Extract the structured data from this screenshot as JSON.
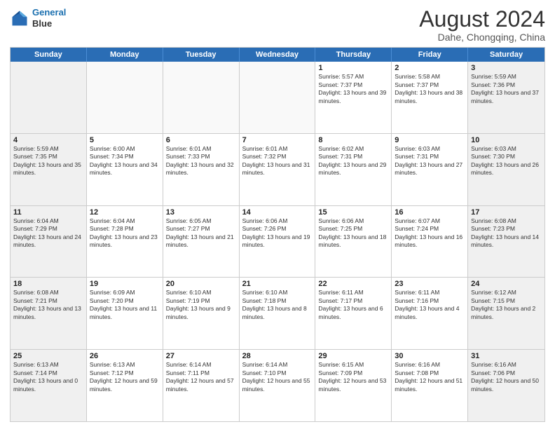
{
  "header": {
    "logo_line1": "General",
    "logo_line2": "Blue",
    "month": "August 2024",
    "location": "Dahe, Chongqing, China"
  },
  "days_of_week": [
    "Sunday",
    "Monday",
    "Tuesday",
    "Wednesday",
    "Thursday",
    "Friday",
    "Saturday"
  ],
  "weeks": [
    [
      {
        "day": "",
        "info": ""
      },
      {
        "day": "",
        "info": ""
      },
      {
        "day": "",
        "info": ""
      },
      {
        "day": "",
        "info": ""
      },
      {
        "day": "1",
        "info": "Sunrise: 5:57 AM\nSunset: 7:37 PM\nDaylight: 13 hours and 39 minutes."
      },
      {
        "day": "2",
        "info": "Sunrise: 5:58 AM\nSunset: 7:37 PM\nDaylight: 13 hours and 38 minutes."
      },
      {
        "day": "3",
        "info": "Sunrise: 5:59 AM\nSunset: 7:36 PM\nDaylight: 13 hours and 37 minutes."
      }
    ],
    [
      {
        "day": "4",
        "info": "Sunrise: 5:59 AM\nSunset: 7:35 PM\nDaylight: 13 hours and 35 minutes."
      },
      {
        "day": "5",
        "info": "Sunrise: 6:00 AM\nSunset: 7:34 PM\nDaylight: 13 hours and 34 minutes."
      },
      {
        "day": "6",
        "info": "Sunrise: 6:01 AM\nSunset: 7:33 PM\nDaylight: 13 hours and 32 minutes."
      },
      {
        "day": "7",
        "info": "Sunrise: 6:01 AM\nSunset: 7:32 PM\nDaylight: 13 hours and 31 minutes."
      },
      {
        "day": "8",
        "info": "Sunrise: 6:02 AM\nSunset: 7:31 PM\nDaylight: 13 hours and 29 minutes."
      },
      {
        "day": "9",
        "info": "Sunrise: 6:03 AM\nSunset: 7:31 PM\nDaylight: 13 hours and 27 minutes."
      },
      {
        "day": "10",
        "info": "Sunrise: 6:03 AM\nSunset: 7:30 PM\nDaylight: 13 hours and 26 minutes."
      }
    ],
    [
      {
        "day": "11",
        "info": "Sunrise: 6:04 AM\nSunset: 7:29 PM\nDaylight: 13 hours and 24 minutes."
      },
      {
        "day": "12",
        "info": "Sunrise: 6:04 AM\nSunset: 7:28 PM\nDaylight: 13 hours and 23 minutes."
      },
      {
        "day": "13",
        "info": "Sunrise: 6:05 AM\nSunset: 7:27 PM\nDaylight: 13 hours and 21 minutes."
      },
      {
        "day": "14",
        "info": "Sunrise: 6:06 AM\nSunset: 7:26 PM\nDaylight: 13 hours and 19 minutes."
      },
      {
        "day": "15",
        "info": "Sunrise: 6:06 AM\nSunset: 7:25 PM\nDaylight: 13 hours and 18 minutes."
      },
      {
        "day": "16",
        "info": "Sunrise: 6:07 AM\nSunset: 7:24 PM\nDaylight: 13 hours and 16 minutes."
      },
      {
        "day": "17",
        "info": "Sunrise: 6:08 AM\nSunset: 7:23 PM\nDaylight: 13 hours and 14 minutes."
      }
    ],
    [
      {
        "day": "18",
        "info": "Sunrise: 6:08 AM\nSunset: 7:21 PM\nDaylight: 13 hours and 13 minutes."
      },
      {
        "day": "19",
        "info": "Sunrise: 6:09 AM\nSunset: 7:20 PM\nDaylight: 13 hours and 11 minutes."
      },
      {
        "day": "20",
        "info": "Sunrise: 6:10 AM\nSunset: 7:19 PM\nDaylight: 13 hours and 9 minutes."
      },
      {
        "day": "21",
        "info": "Sunrise: 6:10 AM\nSunset: 7:18 PM\nDaylight: 13 hours and 8 minutes."
      },
      {
        "day": "22",
        "info": "Sunrise: 6:11 AM\nSunset: 7:17 PM\nDaylight: 13 hours and 6 minutes."
      },
      {
        "day": "23",
        "info": "Sunrise: 6:11 AM\nSunset: 7:16 PM\nDaylight: 13 hours and 4 minutes."
      },
      {
        "day": "24",
        "info": "Sunrise: 6:12 AM\nSunset: 7:15 PM\nDaylight: 13 hours and 2 minutes."
      }
    ],
    [
      {
        "day": "25",
        "info": "Sunrise: 6:13 AM\nSunset: 7:14 PM\nDaylight: 13 hours and 0 minutes."
      },
      {
        "day": "26",
        "info": "Sunrise: 6:13 AM\nSunset: 7:12 PM\nDaylight: 12 hours and 59 minutes."
      },
      {
        "day": "27",
        "info": "Sunrise: 6:14 AM\nSunset: 7:11 PM\nDaylight: 12 hours and 57 minutes."
      },
      {
        "day": "28",
        "info": "Sunrise: 6:14 AM\nSunset: 7:10 PM\nDaylight: 12 hours and 55 minutes."
      },
      {
        "day": "29",
        "info": "Sunrise: 6:15 AM\nSunset: 7:09 PM\nDaylight: 12 hours and 53 minutes."
      },
      {
        "day": "30",
        "info": "Sunrise: 6:16 AM\nSunset: 7:08 PM\nDaylight: 12 hours and 51 minutes."
      },
      {
        "day": "31",
        "info": "Sunrise: 6:16 AM\nSunset: 7:06 PM\nDaylight: 12 hours and 50 minutes."
      }
    ]
  ]
}
